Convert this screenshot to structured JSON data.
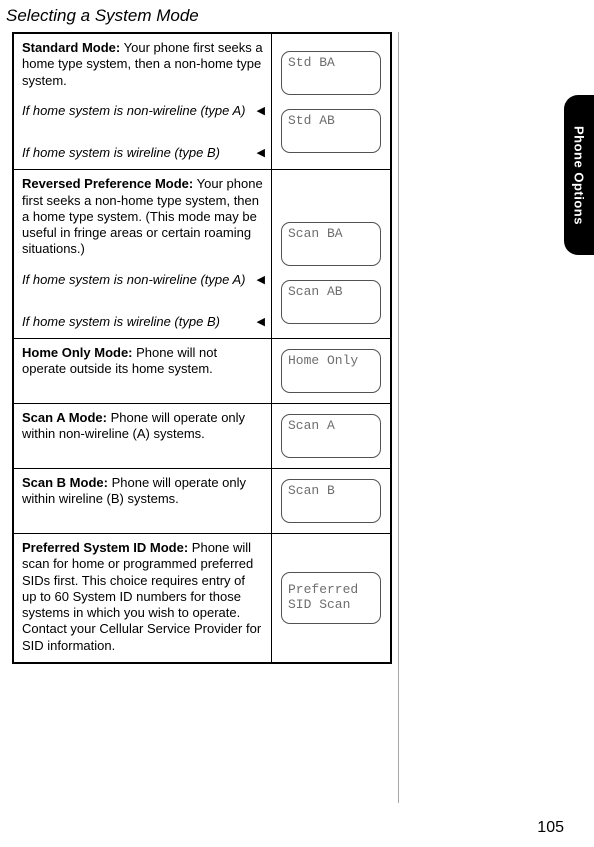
{
  "title": "Selecting a System Mode",
  "side_tab": "Phone Options",
  "page_number": "105",
  "rows": [
    {
      "mode_title": "Standard Mode:",
      "mode_desc": "Your phone first seeks a home type system, then a non-home type system.",
      "subs": [
        {
          "cond": " If home system is non-wireline (type A)",
          "lcd": "Std BA"
        },
        {
          "cond": "If home system is wireline (type B)",
          "lcd": "Std AB"
        }
      ]
    },
    {
      "mode_title": "Reversed Preference Mode:",
      "mode_desc": "Your phone first seeks a non-home type system, then a home type system. (This mode may be useful in fringe areas or certain roaming situations.)",
      "subs": [
        {
          "cond": "If home system is non-wireline (type A)",
          "lcd": "Scan BA"
        },
        {
          "cond": "If home system is wireline (type B)",
          "lcd": "Scan AB"
        }
      ]
    },
    {
      "mode_title": "Home Only Mode:",
      "mode_desc": "Phone will not operate outside its home system.",
      "lcd": "Home Only"
    },
    {
      "mode_title": "Scan A Mode:",
      "mode_desc": "Phone will operate only within non-wireline (A) systems.",
      "lcd": "Scan A"
    },
    {
      "mode_title": "Scan B Mode:",
      "mode_desc": "Phone will operate only within wireline (B) systems.",
      "lcd": "Scan B"
    },
    {
      "mode_title": "Preferred System ID Mode:",
      "mode_desc": "Phone will scan for home or programmed preferred SIDs first. This choice requires entry of up to 60 System ID numbers for those systems in which you wish to operate. Contact your Cellular Service Provider for SID information.",
      "lcd_lines": [
        "Preferred",
        "SID Scan"
      ]
    }
  ]
}
